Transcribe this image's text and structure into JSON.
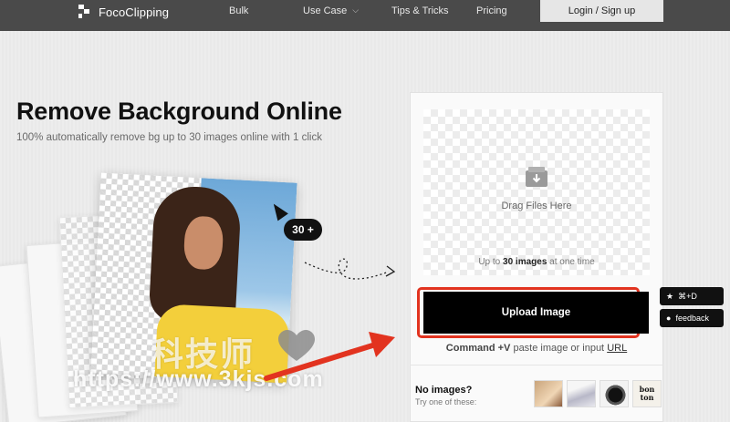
{
  "nav": {
    "brand": "FocoClipping",
    "items": [
      {
        "label": "Bulk"
      },
      {
        "label": "Use Case",
        "caret": "chevron-down-icon"
      },
      {
        "label": "Tips & Tricks"
      },
      {
        "label": "Pricing"
      }
    ],
    "login_label": "Login / Sign up"
  },
  "hero": {
    "title": "Remove Background Online",
    "subtitle": "100% automatically remove bg up to 30 images online with 1 click",
    "count_badge": "30 +"
  },
  "upload": {
    "drag_label": "Drag Files Here",
    "limit_prefix": "Up to ",
    "limit_count": "30 images",
    "limit_suffix": " at one time",
    "button_label": "Upload Image",
    "paste_shortcut": "Command +V",
    "paste_text": " paste image or input ",
    "paste_link": "URL"
  },
  "samples": {
    "title": "No images?",
    "hint": "Try one of these:",
    "thumb_4_text": "bon ton"
  },
  "side": {
    "shortcut_label": "⌘+D",
    "feedback_label": "feedback"
  },
  "watermark": {
    "cn_text": "科技师",
    "url_text": "https://www.3kjs.com"
  },
  "colors": {
    "nav_bg": "#4a4a4a",
    "accent_red": "#e2331f",
    "button_black": "#000000"
  }
}
